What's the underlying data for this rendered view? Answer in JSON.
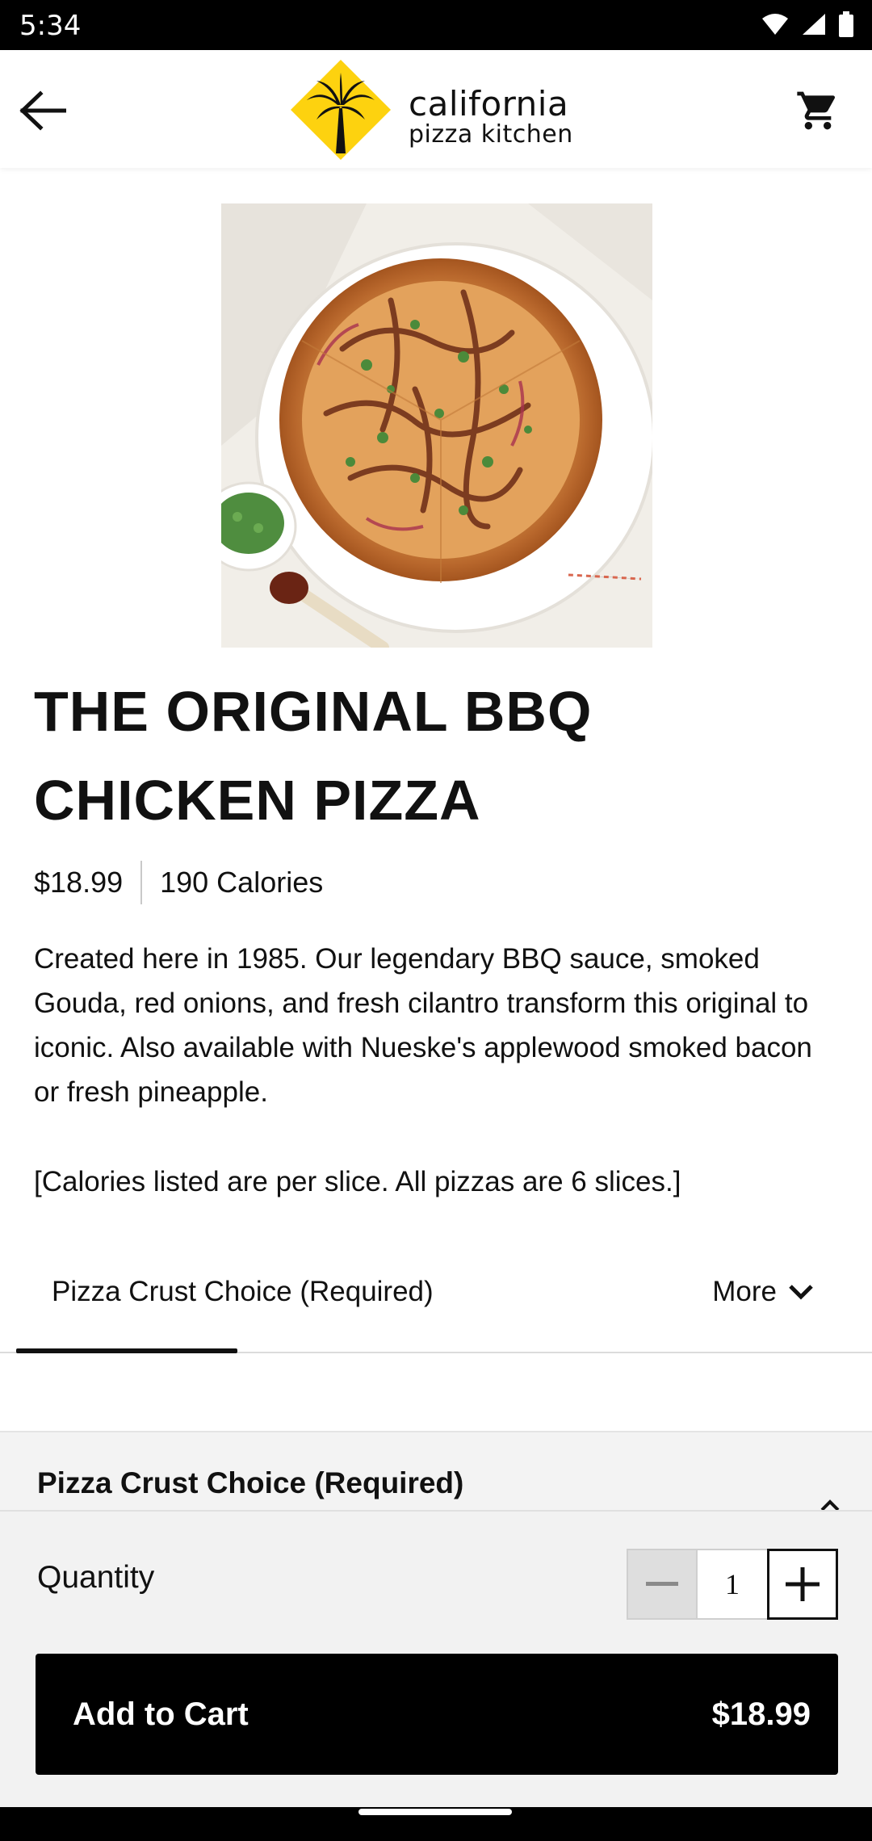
{
  "status_bar": {
    "time": "5:34"
  },
  "header": {
    "logo_line1": "california",
    "logo_line2": "pizza kitchen"
  },
  "item": {
    "title": "THE ORIGINAL BBQ CHICKEN PIZZA",
    "price": "$18.99",
    "calories": "190 Calories",
    "description": "Created here in 1985. Our legendary BBQ sauce, smoked Gouda, red onions, and fresh cilantro transform this original to iconic. Also available with Nueske's applewood smoked bacon or fresh pineapple.",
    "note": "[Calories listed are per slice. All pizzas are 6 slices.]"
  },
  "tabs": {
    "active": "Pizza Crust Choice (Required)",
    "more": "More"
  },
  "section": {
    "title": "Pizza Crust Choice (Required)"
  },
  "quantity": {
    "label": "Quantity",
    "value": "1"
  },
  "cta": {
    "label": "Add to Cart",
    "price": "$18.99"
  },
  "colors": {
    "brand_yellow": "#FDD20F",
    "cta_bg": "#000000"
  },
  "icons": [
    "back-arrow-icon",
    "cart-icon",
    "chevron-down-icon",
    "minus-icon",
    "plus-icon"
  ]
}
